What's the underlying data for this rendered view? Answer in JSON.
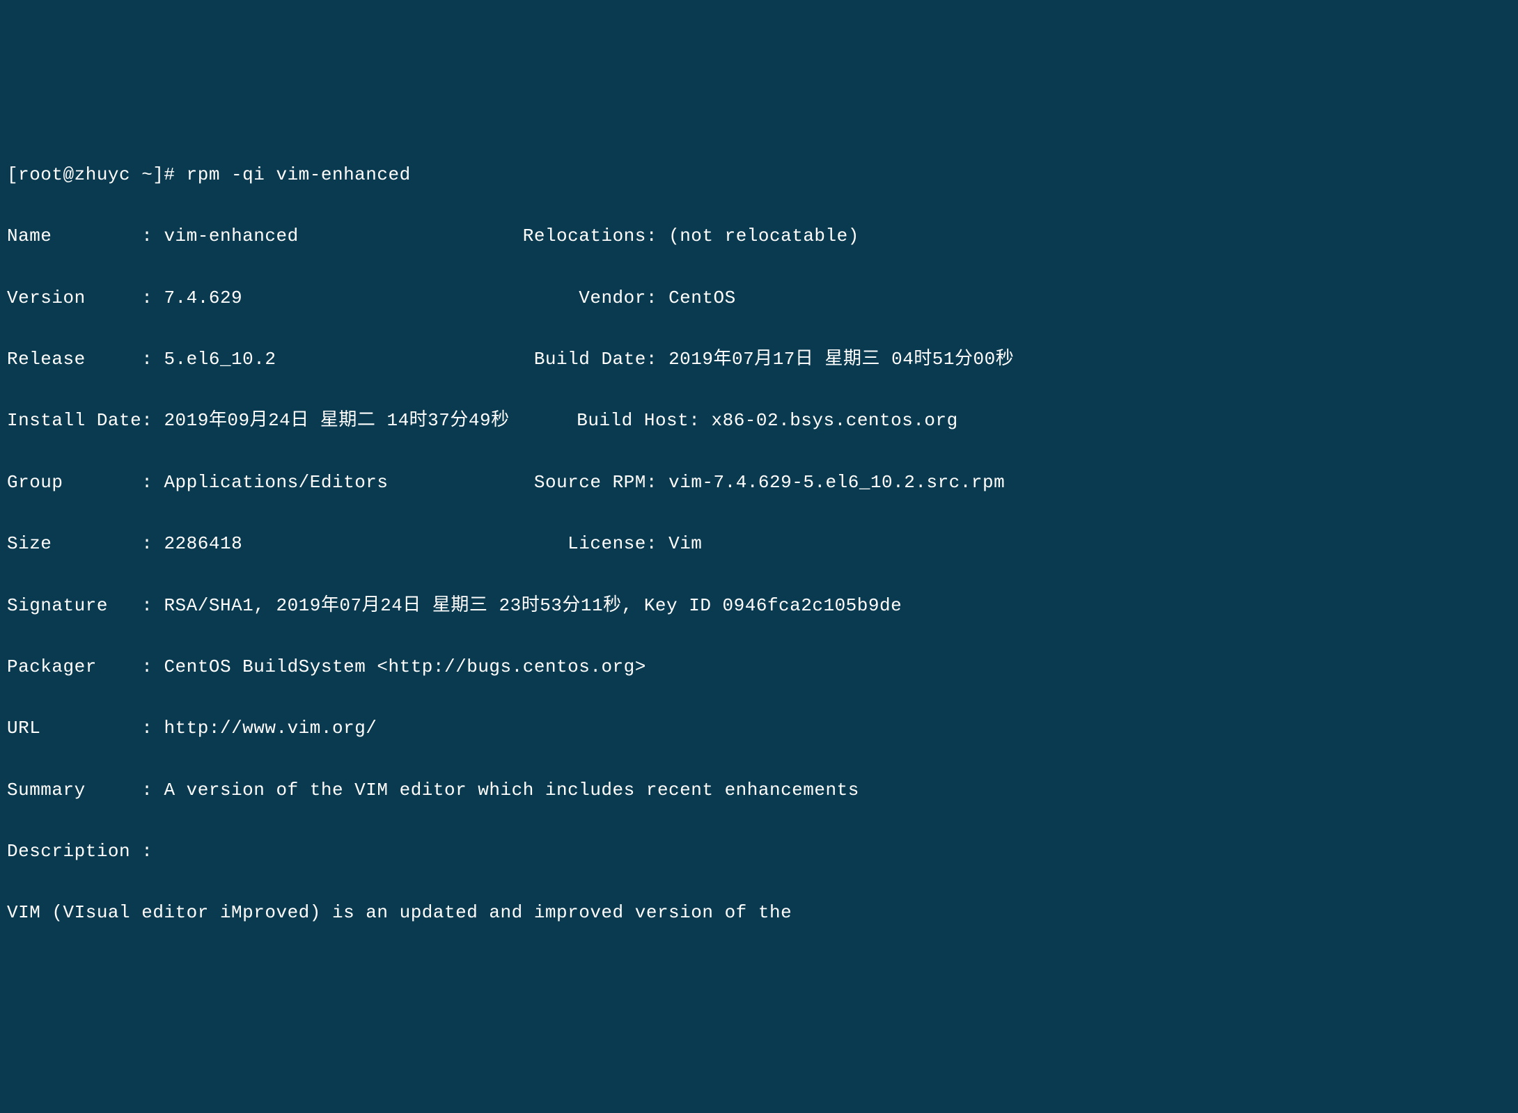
{
  "prompt": "[root@zhuyc ~]# rpm -qi vim-enhanced",
  "fields": {
    "name_label": "Name",
    "name_value": "vim-enhanced",
    "relocations_label": "Relocations:",
    "relocations_value": "(not relocatable)",
    "version_label": "Version",
    "version_value": "7.4.629",
    "vendor_label": "Vendor:",
    "vendor_value": "CentOS",
    "release_label": "Release",
    "release_value": "5.el6_10.2",
    "builddate_label": "Build Date:",
    "builddate_value": "2019年07月17日 星期三 04时51分00秒",
    "installdate_label": "Install Date:",
    "installdate_value": "2019年09月24日 星期二 14时37分49秒",
    "buildhost_label": "Build Host:",
    "buildhost_value": "x86-02.bsys.centos.org",
    "group_label": "Group",
    "group_value": "Applications/Editors",
    "sourcerpm_label": "Source RPM:",
    "sourcerpm_value": "vim-7.4.629-5.el6_10.2.src.rpm",
    "size_label": "Size",
    "size_value": "2286418",
    "license_label": "License:",
    "license_value": "Vim",
    "signature_label": "Signature",
    "signature_value": "RSA/SHA1, 2019年07月24日 星期三 23时53分11秒, Key ID 0946fca2c105b9de",
    "packager_label": "Packager",
    "packager_value": "CentOS BuildSystem <http://bugs.centos.org>",
    "url_label": "URL",
    "url_value": "http://www.vim.org/",
    "summary_label": "Summary",
    "summary_value": "A version of the VIM editor which includes recent enhancements",
    "description_label": "Description :",
    "description_value": "VIM (VIsual editor iMproved) is an updated and improved version of the"
  }
}
